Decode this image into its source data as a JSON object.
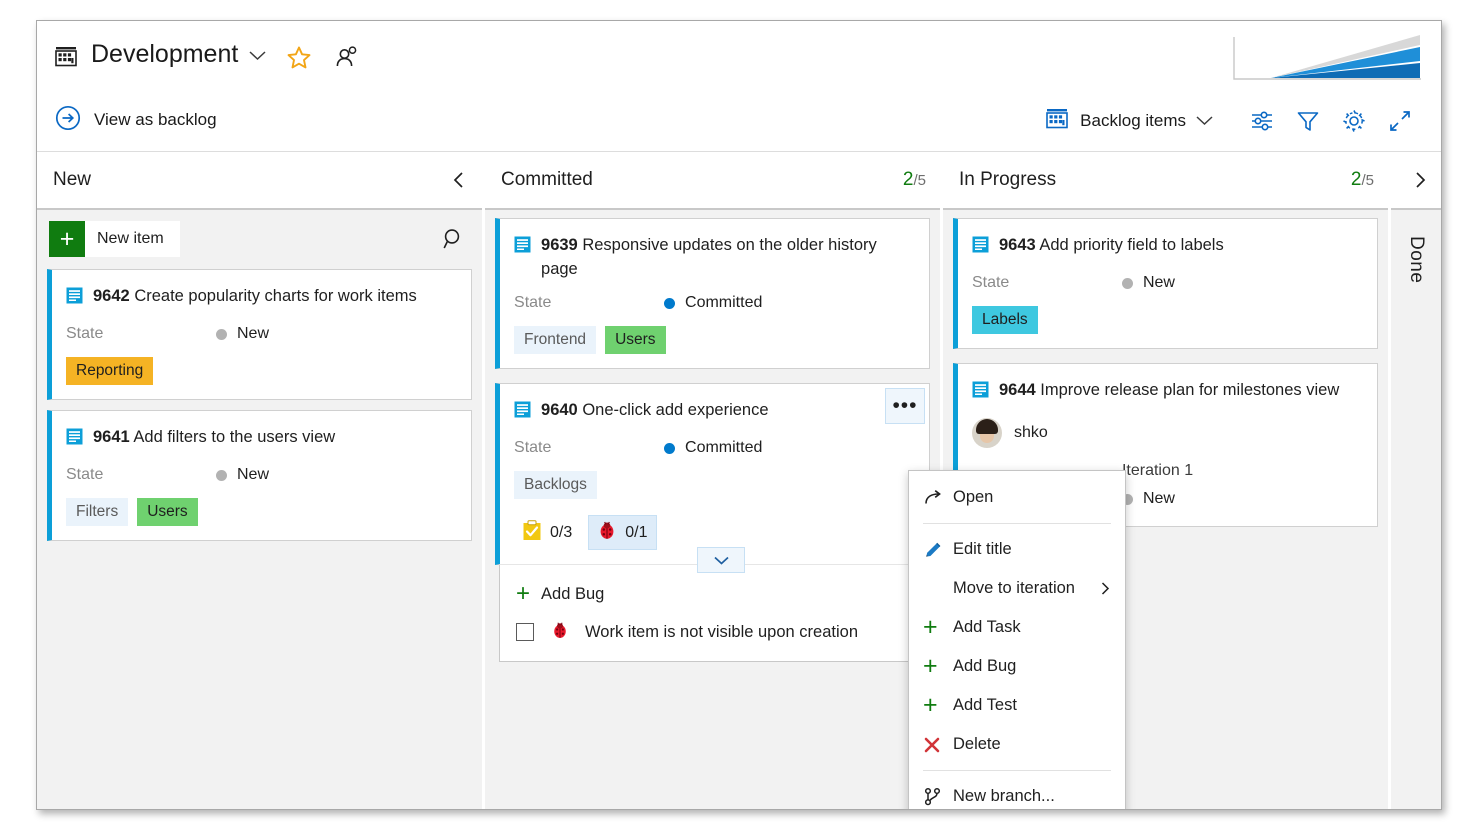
{
  "header": {
    "board_icon": "board-grid-icon",
    "title": "Development",
    "title_chevron": "chevron-down-icon",
    "favorite_icon": "star-icon",
    "team_icon": "people-icon",
    "velocity_chart_icon": "velocity-sparkline-chart"
  },
  "toolbar": {
    "view_as_backlog": "View as backlog",
    "view_as_backlog_icon": "arrow-right-circle-icon",
    "backlog_level": "Backlog items",
    "backlog_level_icon": "board-grid-icon",
    "backlog_level_chevron": "chevron-down-icon",
    "buttons": [
      {
        "name": "board-settings-sliders-icon",
        "glyph": "sliders"
      },
      {
        "name": "filter-icon",
        "glyph": "funnel"
      },
      {
        "name": "settings-gear-icon",
        "glyph": "gear"
      },
      {
        "name": "fullscreen-expand-icon",
        "glyph": "expand"
      }
    ]
  },
  "board": {
    "columns": [
      {
        "title": "New",
        "limit_current": "",
        "limit_max": "",
        "collapse_icon": "chevron-left-icon",
        "new_item_label": "New item",
        "new_item_plus": "+",
        "search_icon": "search-icon",
        "cards": [
          {
            "id": "9642",
            "title": "Create popularity charts for work items",
            "type_icon": "backlog-item-icon",
            "field_label": "State",
            "state": "New",
            "state_style": "new",
            "tags": [
              {
                "text": "Reporting",
                "color": "#f5b324"
              }
            ]
          },
          {
            "id": "9641",
            "title": "Add filters to the users view",
            "type_icon": "backlog-item-icon",
            "field_label": "State",
            "state": "New",
            "state_style": "new",
            "tags": [
              {
                "text": "Filters",
                "color": "#eaf3fb"
              },
              {
                "text": "Users",
                "color": "#6fd16f"
              }
            ]
          }
        ]
      },
      {
        "title": "Committed",
        "limit_current": "2",
        "limit_max": "/5",
        "cards": [
          {
            "id": "9639",
            "title": "Responsive updates on the older history page",
            "type_icon": "backlog-item-icon",
            "field_label": "State",
            "state": "Committed",
            "state_style": "committed",
            "tags": [
              {
                "text": "Frontend",
                "color": "#eaf3fb"
              },
              {
                "text": "Users",
                "color": "#6fd16f"
              }
            ]
          },
          {
            "id": "9640",
            "title": "One-click add experience",
            "type_icon": "backlog-item-icon",
            "field_label": "State",
            "state": "Committed",
            "state_style": "committed",
            "tags": [
              {
                "text": "Backlogs",
                "color": "#eaf3fb"
              }
            ],
            "counters": [
              {
                "icon": "task-checklist-icon",
                "value": "0/3",
                "selected": false
              },
              {
                "icon": "bug-ladybug-icon",
                "value": "0/1",
                "selected": true
              }
            ],
            "expand_icon": "chevron-down-icon",
            "menu_icon": "more-actions-ellipsis-icon",
            "inline_panel": {
              "add_label": "Add Bug",
              "add_plus": "+",
              "checklist_item": "Work item is not visible upon creation",
              "checklist_icon": "bug-ladybug-icon"
            }
          }
        ]
      },
      {
        "title": "In Progress",
        "limit_current": "2",
        "limit_max": "/5",
        "expand_icon": "chevron-right-icon",
        "cards": [
          {
            "id": "9643",
            "title": "Add priority field to labels",
            "type_icon": "backlog-item-icon",
            "field_label": "State",
            "state": "New",
            "state_style": "new",
            "tags": [
              {
                "text": "Labels",
                "color": "#3ec8e0"
              }
            ]
          },
          {
            "id": "9644",
            "title": "Improve release plan for milestones view",
            "type_icon": "backlog-item-icon",
            "assignee": "shko",
            "avatar_icon": "user-avatar",
            "iteration": "Iteration 1",
            "state": "New",
            "state_style": "new"
          }
        ]
      },
      {
        "title": "Done",
        "collapsed": true
      }
    ]
  },
  "context_menu": {
    "items": [
      {
        "label": "Open",
        "icon": "open-arrow-icon",
        "submenu": false
      },
      {
        "separator": true
      },
      {
        "label": "Edit title",
        "icon": "pencil-edit-icon",
        "submenu": false
      },
      {
        "label": "Move to iteration",
        "icon": "",
        "submenu": true,
        "submenu_icon": "chevron-right-icon"
      },
      {
        "label": "Add Task",
        "icon": "plus-icon",
        "submenu": false
      },
      {
        "label": "Add Bug",
        "icon": "plus-icon",
        "submenu": false
      },
      {
        "label": "Add Test",
        "icon": "plus-icon",
        "submenu": false
      },
      {
        "label": "Delete",
        "icon": "delete-x-icon",
        "submenu": false
      },
      {
        "separator": true
      },
      {
        "label": "New branch...",
        "icon": "branch-icon",
        "submenu": false
      }
    ]
  },
  "colors": {
    "accent_blue": "#0c9fd8",
    "state_committed": "#007acc",
    "state_new": "#b2b2b2",
    "limit_ok": "#107c10",
    "add_green": "#107c10",
    "delete_red": "#d13438"
  }
}
